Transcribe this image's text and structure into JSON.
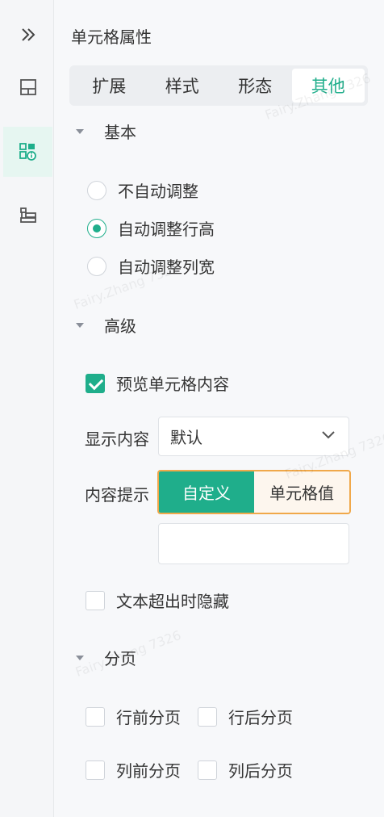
{
  "sidebar": {
    "collapse_icon": "double-chevron-right-icon",
    "items": [
      {
        "icon": "layout-icon",
        "active": false
      },
      {
        "icon": "cell-info-icon",
        "active": true
      },
      {
        "icon": "component-list-icon",
        "active": false
      }
    ]
  },
  "panel": {
    "title": "单元格属性",
    "tabs": [
      {
        "label": "扩展",
        "active": false
      },
      {
        "label": "样式",
        "active": false
      },
      {
        "label": "形态",
        "active": false
      },
      {
        "label": "其他",
        "active": true
      }
    ]
  },
  "basic": {
    "heading": "基本",
    "options": [
      {
        "label": "不自动调整",
        "selected": false
      },
      {
        "label": "自动调整行高",
        "selected": true
      },
      {
        "label": "自动调整列宽",
        "selected": false
      }
    ]
  },
  "advanced": {
    "heading": "高级",
    "preview_label": "预览单元格内容",
    "preview_checked": true,
    "display_label": "显示内容",
    "display_value": "默认",
    "hint_label": "内容提示",
    "hint_options": [
      {
        "label": "自定义",
        "active": true
      },
      {
        "label": "单元格值",
        "active": false
      }
    ],
    "hint_input_value": "",
    "overflow_label": "文本超出时隐藏",
    "overflow_checked": false
  },
  "pagination": {
    "heading": "分页",
    "options": [
      {
        "label": "行前分页",
        "checked": false
      },
      {
        "label": "行后分页",
        "checked": false
      },
      {
        "label": "列前分页",
        "checked": false
      },
      {
        "label": "列后分页",
        "checked": false
      }
    ]
  },
  "watermark_text": "Fairy.Zhang 7326",
  "colors": {
    "accent": "#1fae8b",
    "highlight_border": "#f0a84a"
  }
}
